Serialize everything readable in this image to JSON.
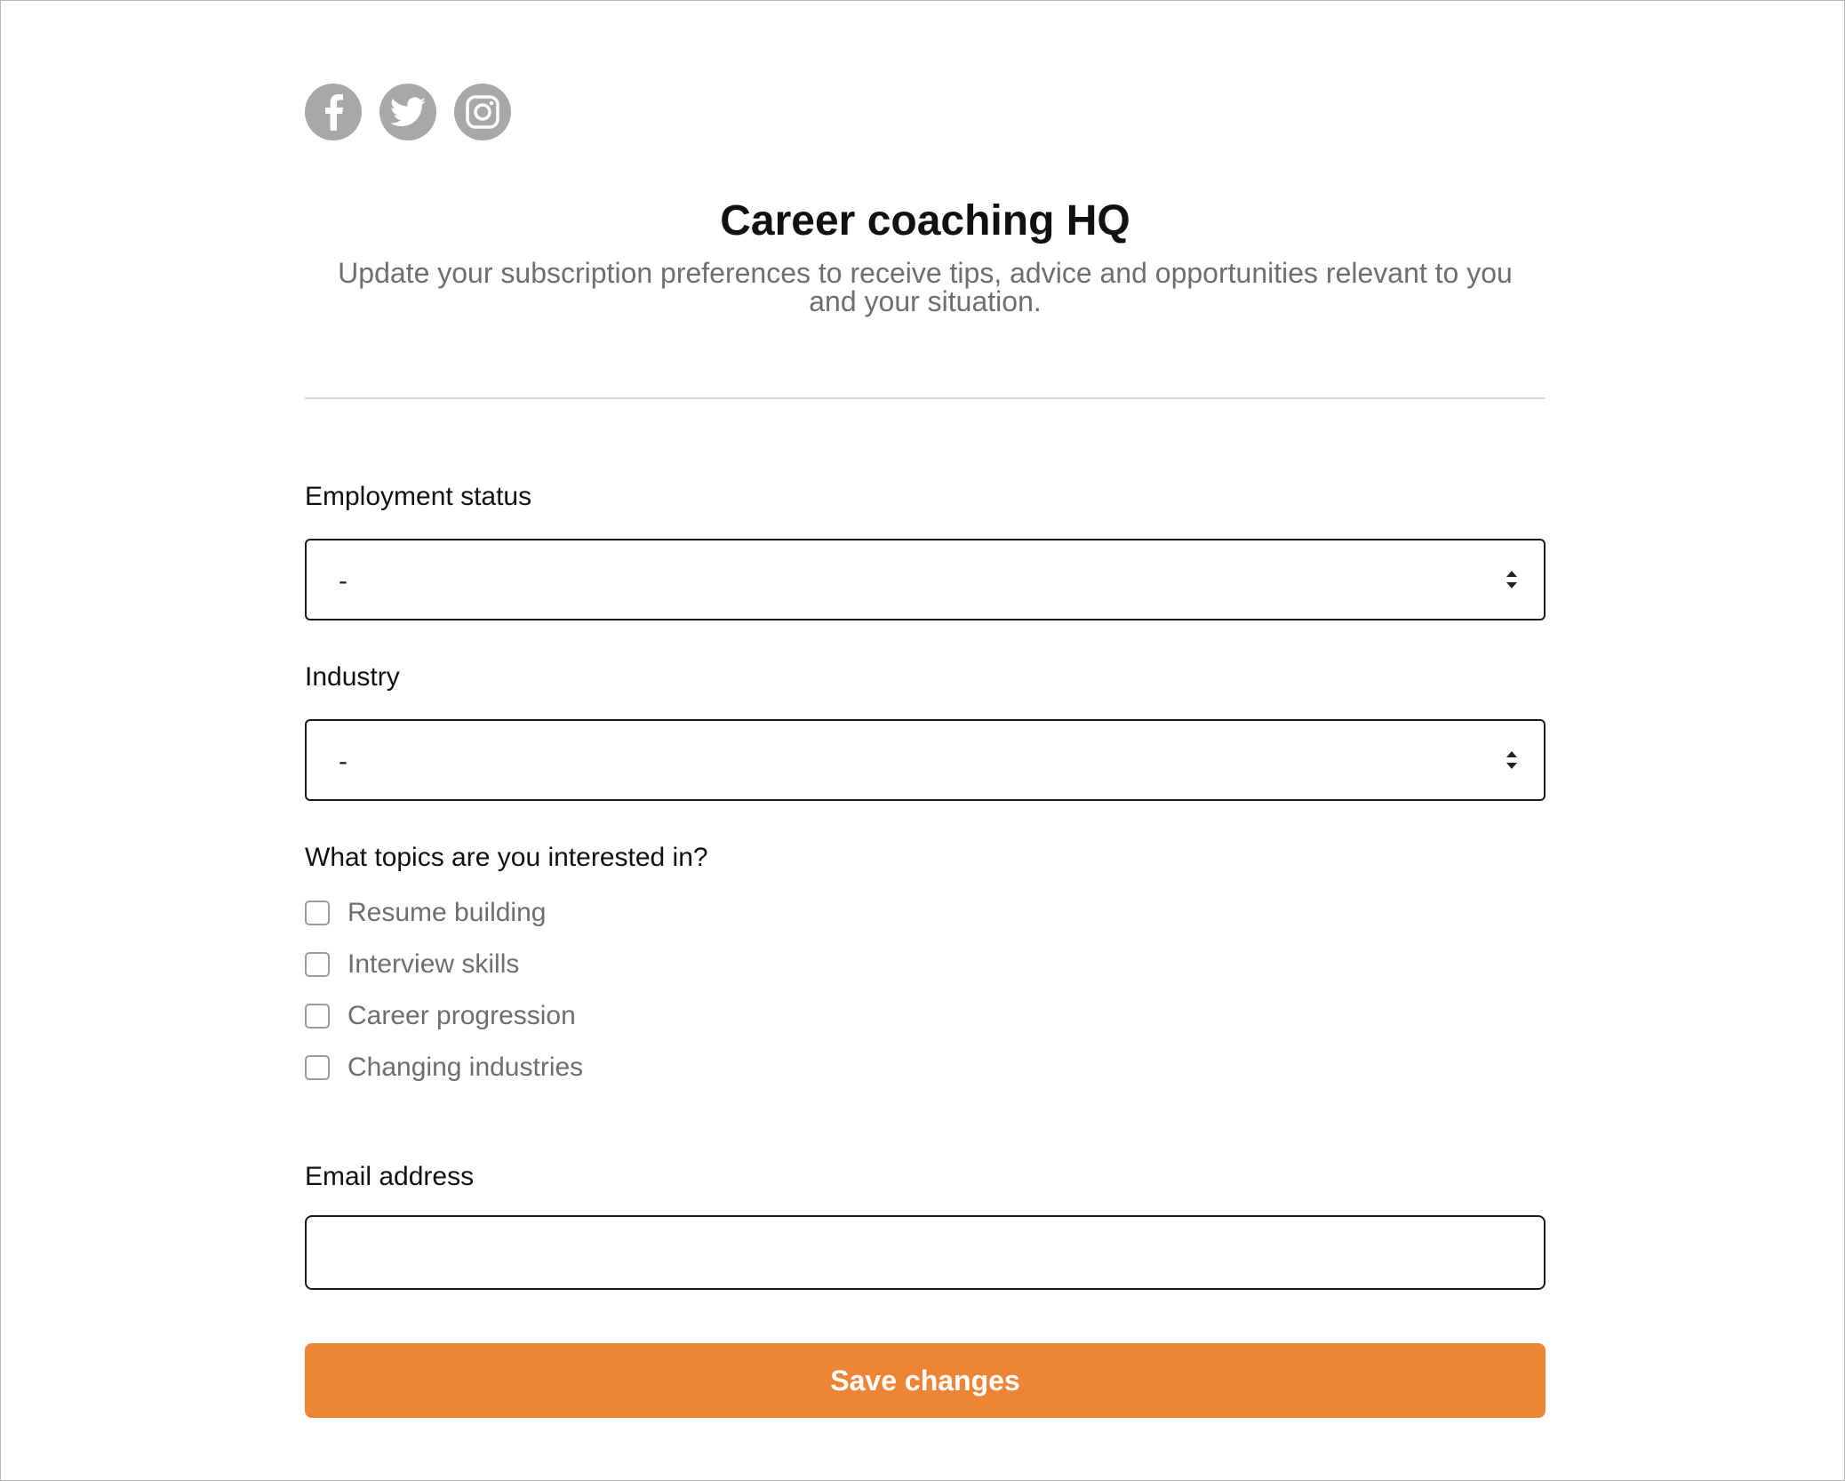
{
  "social": {
    "icons": [
      "facebook-icon",
      "twitter-icon",
      "instagram-icon"
    ],
    "icon_color": "#a8a8a8"
  },
  "header": {
    "title": "Career coaching HQ",
    "subtitle": "Update your subscription preferences to receive tips, advice and opportunities relevant to you and your situation."
  },
  "form": {
    "employment_status": {
      "label": "Employment status",
      "value": "-"
    },
    "industry": {
      "label": "Industry",
      "value": "-"
    },
    "topics": {
      "label": "What topics are you interested in?",
      "options": [
        {
          "label": "Resume building",
          "checked": false
        },
        {
          "label": "Interview skills",
          "checked": false
        },
        {
          "label": "Career progression",
          "checked": false
        },
        {
          "label": "Changing industries",
          "checked": false
        }
      ]
    },
    "email": {
      "label": "Email address",
      "value": "",
      "placeholder": ""
    },
    "submit_label": "Save changes"
  },
  "colors": {
    "accent": "#ee8536",
    "label_text": "#111111",
    "muted_text": "#6e6e6e"
  }
}
